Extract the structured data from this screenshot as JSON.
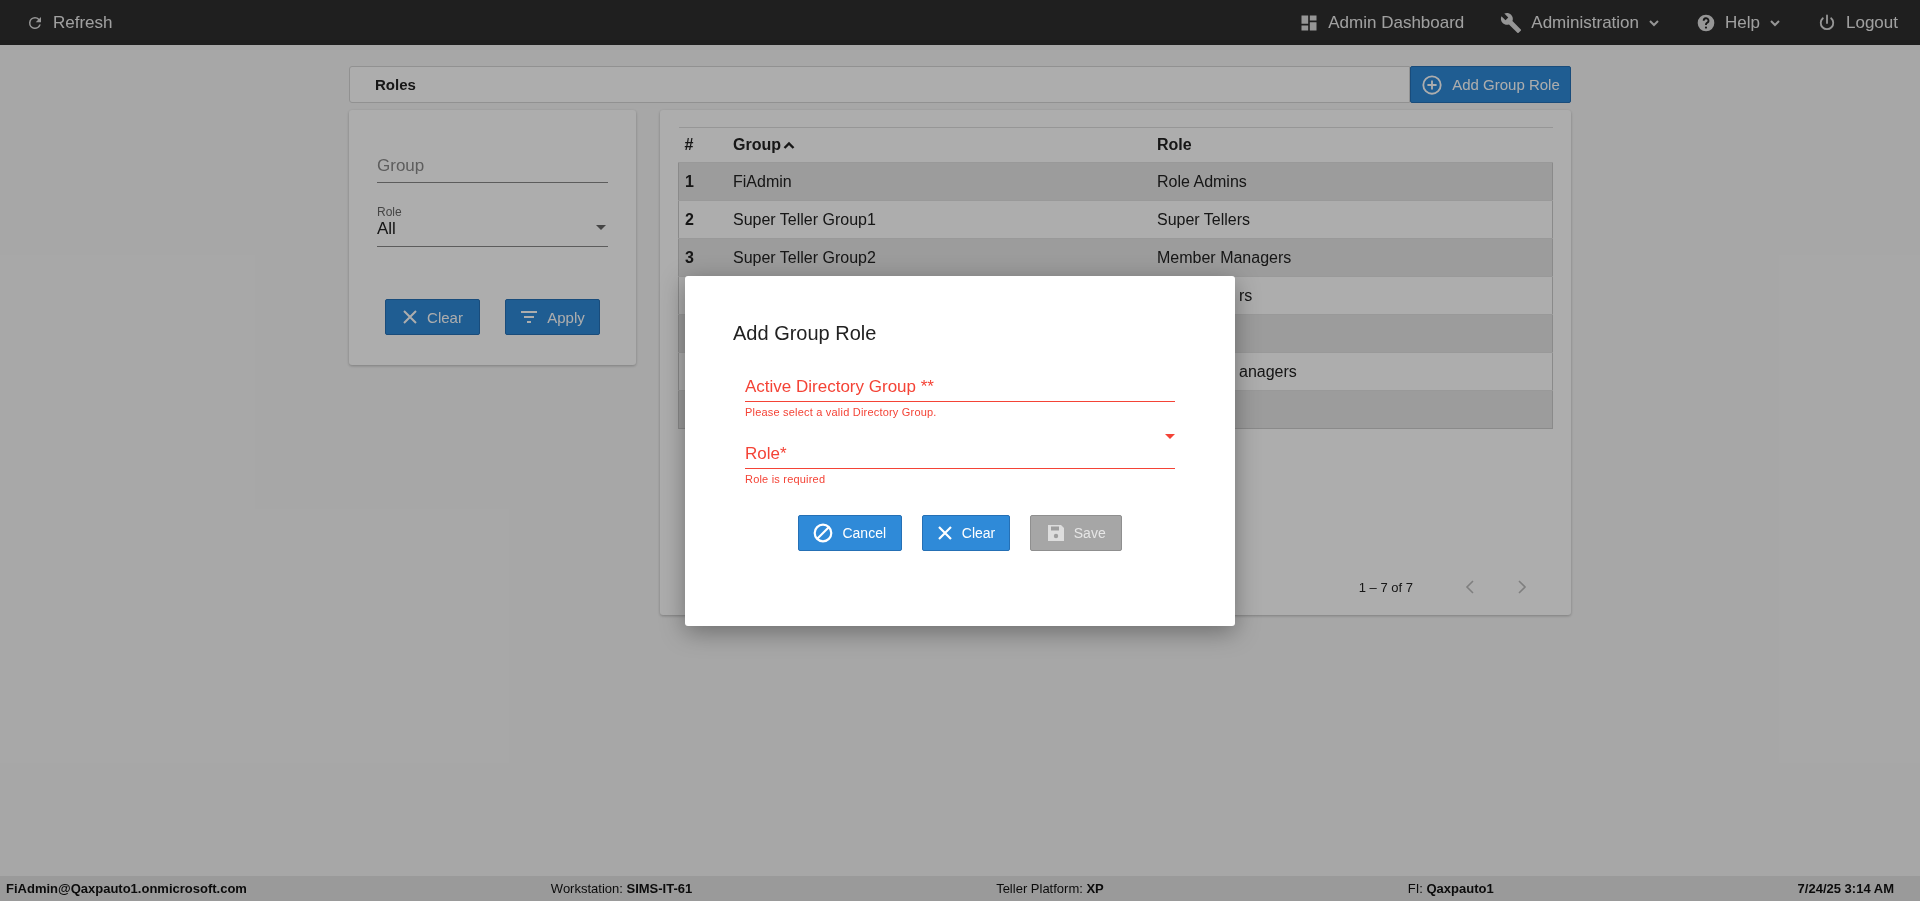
{
  "topbar": {
    "refresh": "Refresh",
    "items": [
      {
        "label": "Admin Dashboard",
        "kind": "dashboard",
        "menu": false
      },
      {
        "label": "Administration",
        "kind": "wrench",
        "menu": true
      },
      {
        "label": "Help",
        "kind": "help",
        "menu": true
      },
      {
        "label": "Logout",
        "kind": "power",
        "menu": false
      }
    ]
  },
  "page": {
    "title": "Roles",
    "add_button": "Add Group Role"
  },
  "filters": {
    "group": {
      "placeholder": "Group"
    },
    "role": {
      "label": "Role",
      "value": "All"
    },
    "buttons": [
      {
        "label": "Clear",
        "kind": "clear"
      },
      {
        "label": "Apply",
        "kind": "filter"
      }
    ]
  },
  "table": {
    "columns": [
      {
        "label": "#",
        "sorted": false
      },
      {
        "label": "Group",
        "sorted": true
      },
      {
        "label": "Role",
        "sorted": false
      }
    ],
    "rows": [
      {
        "number": "1",
        "group": "FiAdmin",
        "role": "Role Admins"
      },
      {
        "number": "2",
        "group": "Super Teller Group1",
        "role": "Super Tellers"
      },
      {
        "number": "3",
        "group": "Super Teller Group2",
        "role": "Member Managers"
      },
      {
        "role": "rs"
      },
      {},
      {
        "role": "anagers"
      },
      {}
    ],
    "pagination": "1 – 7 of 7"
  },
  "dialog": {
    "title": "Add Group Role",
    "fields": [
      {
        "kind": "text",
        "placeholder": "Active Directory Group **",
        "error": "Please select a valid Directory Group."
      },
      {
        "kind": "select",
        "label": "Role*",
        "error": "Role is required"
      }
    ],
    "buttons": [
      {
        "label": "Cancel",
        "kind": "cancel",
        "disabled": false
      },
      {
        "label": "Clear",
        "kind": "clear",
        "disabled": false
      },
      {
        "label": "Save",
        "kind": "save",
        "disabled": true
      }
    ]
  },
  "status_bar": {
    "user": "FiAdmin@Qaxpauto1.onmicrosoft.com",
    "items": [
      "Workstation: **SIMS-IT-61**",
      "Teller Platform: **XP**",
      "FI: **Qaxpauto1**"
    ],
    "datetime": "7/24/25 3:14 AM"
  }
}
